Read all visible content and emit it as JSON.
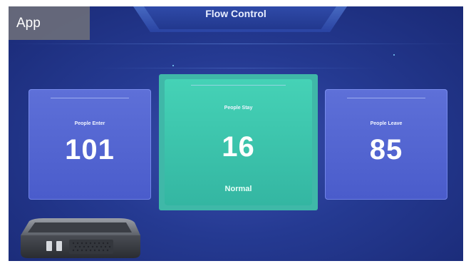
{
  "app_badge": "App",
  "header": {
    "title": "Flow Control"
  },
  "cards": {
    "enter": {
      "label": "People Enter",
      "value": "101"
    },
    "stay": {
      "label": "People Stay",
      "value": "16",
      "status": "Normal"
    },
    "leave": {
      "label": "People Leave",
      "value": "85"
    }
  },
  "colors": {
    "background": "#253a92",
    "side_card": "#5566d4",
    "center_card": "#3fc4ad",
    "title_text": "#e8eeff"
  },
  "device": {
    "icon": "mini-pc-box"
  }
}
